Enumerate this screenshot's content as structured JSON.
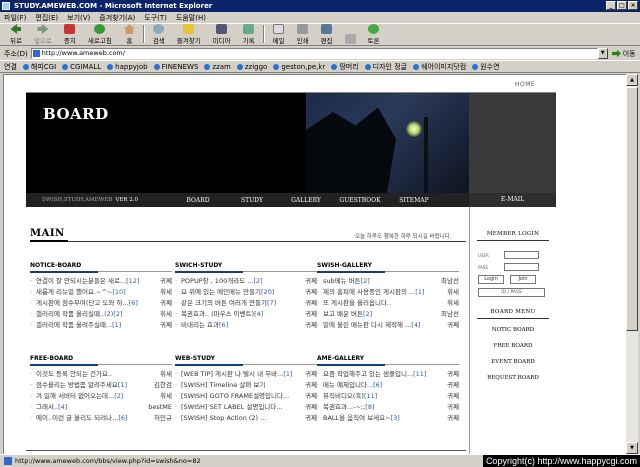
{
  "window": {
    "title": "STUDY.AMEWEB.COM - Microsoft Internet Explorer",
    "buttons": [
      "_",
      "□",
      "×"
    ]
  },
  "menu": [
    "파일(F)",
    "편집(E)",
    "보기(V)",
    "즐겨찾기(A)",
    "도구(T)",
    "도움말(H)"
  ],
  "toolbar": [
    {
      "label": "뒤로",
      "icon": "back-arrow-icon"
    },
    {
      "label": "앞으로",
      "icon": "forward-arrow-icon"
    },
    {
      "label": "중지",
      "icon": "stop-icon"
    },
    {
      "label": "새로고침",
      "icon": "refresh-icon"
    },
    {
      "label": "홈",
      "icon": "home-icon"
    },
    {
      "label": "검색",
      "icon": "search-icon"
    },
    {
      "label": "즐겨찾기",
      "icon": "favorites-icon"
    },
    {
      "label": "미디어",
      "icon": "media-icon"
    },
    {
      "label": "기록",
      "icon": "history-icon"
    },
    {
      "label": "메일",
      "icon": "mail-icon"
    },
    {
      "label": "인쇄",
      "icon": "print-icon"
    },
    {
      "label": "편집",
      "icon": "edit-icon"
    },
    {
      "label": "",
      "icon": "discuss-icon"
    },
    {
      "label": "토론",
      "icon": "messenger-icon"
    }
  ],
  "address": {
    "label": "주소(D)",
    "url": "http://www.ameweb.com/",
    "go": "이동"
  },
  "links": {
    "label": "연결",
    "items": [
      "해피CGI",
      "CGIMALL",
      "happyjob",
      "FINENEWS",
      "zzam",
      "zziggo",
      "geston,pe,kr",
      "땅머리",
      "디자인 정글",
      "쉐어이미지닷컴",
      "원수연"
    ]
  },
  "site": {
    "home": "HOME",
    "banner_title": "BOARD",
    "brand": "SWISH,STUDY,AMEWEB",
    "version": "VER  2.0",
    "nav": [
      "BOARD",
      "STUDY",
      "GALLERY",
      "GUESTBOOK",
      "SITEMAP"
    ],
    "email": "E-MAIL",
    "main_title": "MAIN",
    "tagline": "오늘 하루도 행복한 하루 되시길 바랍니다.",
    "sections": [
      {
        "title": "NOTICE-BOARD",
        "items": [
          {
            "text": "연결이 잘 안되시는분들은 새로...",
            "count": "[12]",
            "author": "귀쩨"
          },
          {
            "text": "새롭게 리뉴얼 했어요.~^~",
            "count": "[10]",
            "author": "휘세"
          },
          {
            "text": "게시판에 점수부여(단고 도와 하...",
            "count": "[6]",
            "author": "귀쩨"
          },
          {
            "text": "갤러리에 작품 올리실때..",
            "count": "(2)[2]",
            "author": "휘세"
          },
          {
            "text": "갤러리에 작품 올려주실때...",
            "count": "[1]",
            "author": "귀쩨"
          }
        ]
      },
      {
        "title": "SWICH-STUDY",
        "items": [
          {
            "text": "POPUP창 , 100개라도 ...",
            "count": "[2]",
            "author": "귀쩨"
          },
          {
            "text": "요 위에 있는 메인메뉴 만들기",
            "count": "[20]",
            "author": "귀쩨"
          },
          {
            "text": "같은 크기의 버튼 여러개 만들기",
            "count": "[7]",
            "author": "귀쩨"
          },
          {
            "text": "복권효과.. (마우스 이벤트)",
            "count": "[4]",
            "author": "귀쩨"
          },
          {
            "text": "비내리는 효과",
            "count": "[6]",
            "author": "귀쩨"
          }
        ]
      },
      {
        "title": "SWISH-GALLERY",
        "items": [
          {
            "text": "sub메뉴 버튼",
            "count": "[2]",
            "author": "최남선"
          },
          {
            "text": "제의 홈피에 사용중인 게시판의 ...",
            "count": "[1]",
            "author": "휘세"
          },
          {
            "text": "또 게시판을 올리옵니다..",
            "count": "",
            "author": "휘세"
          },
          {
            "text": "보고 배운 버튼",
            "count": "[2]",
            "author": "최남선"
          },
          {
            "text": "밑에 올린 메뉴판 다시 제작해 ...",
            "count": "[4]",
            "author": "귀쩨"
          }
        ]
      },
      {
        "title": "FREE-BOARD",
        "items": [
          {
            "text": "이것도 등록 안되는 건가요..",
            "count": "",
            "author": "휘세"
          },
          {
            "text": "점수올리는 방법좀 알려주세요",
            "count": "[1]",
            "author": "김한검"
          },
          {
            "text": "겨 일해 서버터 없어오는데...",
            "count": "[2]",
            "author": "휘세"
          },
          {
            "text": "그래서..",
            "count": "[4]",
            "author": "bestME"
          },
          {
            "text": "에이..이런 글 올리도 되려나...",
            "count": "[6]",
            "author": "허민규"
          }
        ]
      },
      {
        "title": "WEB-STUDY",
        "items": [
          {
            "text": "[WEB TIP] 게시판 나 텔시 내 무바...",
            "count": "[1]",
            "author": "귀쩨"
          },
          {
            "text": "[SWISH] Timeline 살펴 보기",
            "count": "",
            "author": "귀쩨"
          },
          {
            "text": "[SWISH] GOTO FRAME설명입니다...",
            "count": "",
            "author": "귀쩨"
          },
          {
            "text": "[SWISH] SET LABEL 설명입니다...",
            "count": "",
            "author": "귀쩨"
          },
          {
            "text": "[SWISH] Stop Action (2) ...",
            "count": "",
            "author": "귀쩨"
          }
        ]
      },
      {
        "title": "AME-GALLERY",
        "items": [
          {
            "text": "요즘 작업해주고 있는 샘플입니...",
            "count": "[11]",
            "author": "귀쩨"
          },
          {
            "text": "메뉴 예제입니다...",
            "count": "[6]",
            "author": "귀쩨"
          },
          {
            "text": "뮤직비디오(흑)",
            "count": "[11]",
            "author": "귀쩨"
          },
          {
            "text": "복권효과...-~;;",
            "count": "[8]",
            "author": "귀쩨"
          },
          {
            "text": "BALL을 움직여 보세요~",
            "count": "[3]",
            "author": "귀쩨"
          }
        ]
      }
    ],
    "login": {
      "title": "MEMBER  LOGIN",
      "user_label": "USER",
      "pass_label": "PASS",
      "login_btn": "Login",
      "join_btn": "Join",
      "find_btn": "ID  /  PASS"
    },
    "board_menu": {
      "title": "BOARD  MENU",
      "items": [
        "NOTIC BOARD",
        "FREE BOARD",
        "EVENT BOARD",
        "REQUEST BOARD"
      ]
    }
  },
  "status": {
    "url": "http://www.ameweb.com/bbs/view.php?id=swish&no=82",
    "copyright": "Copyright(c) http://www.happycgi.com"
  }
}
